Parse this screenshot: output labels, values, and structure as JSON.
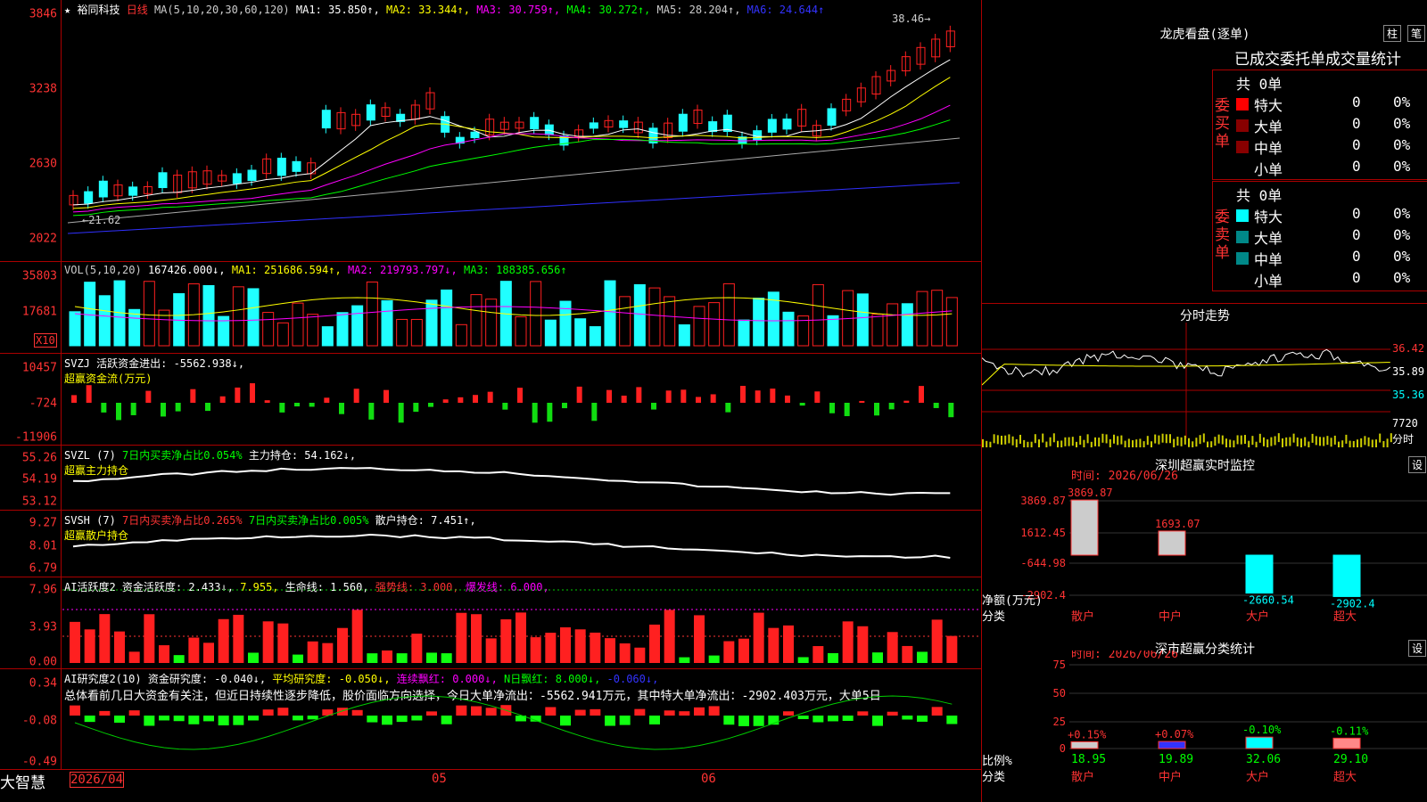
{
  "colors": {
    "up": "#ff2020",
    "down": "#20ffff",
    "ma1": "#ffffff",
    "ma2": "#ffff00",
    "ma3": "#ff00ff",
    "ma4": "#00ff00",
    "ma5": "#aaaaaa",
    "ma6": "#3030ff"
  },
  "main": {
    "title": "★ 裕同科技",
    "period": "日线",
    "ma_label": "MA(5,10,20,30,60,120)",
    "ma1": "MA1: 35.850↑,",
    "ma2": "MA2: 33.344↑,",
    "ma3": "MA3: 30.759↑,",
    "ma4": "MA4: 30.272↑,",
    "ma5": "MA5: 28.204↑,",
    "ma6": "MA6: 24.644↑",
    "hi_label": "38.46→",
    "lo_label": "←21.62",
    "ticks": [
      "3846",
      "3238",
      "2630",
      "2022"
    ]
  },
  "vol": {
    "label": "VOL(5,10,20)",
    "v": "167426.000↓,",
    "ma1": "MA1: 251686.594↑,",
    "ma2": "MA2: 219793.797↓,",
    "ma3": "MA3: 188385.656↑",
    "ticks": [
      "35803",
      "17681"
    ],
    "unit": "X10"
  },
  "svzj": {
    "label": "SVZJ  活跃资金进出: -5562.938↓,",
    "sub": "超赢资金流(万元)",
    "ticks": [
      "10457",
      "-724",
      "-11906"
    ]
  },
  "svzl": {
    "label": "SVZL (7)",
    "g": "7日内买卖净占比0.054%",
    "w": "主力持仓: 54.162↓,",
    "sub": "超赢主力持仓",
    "ticks": [
      "55.26",
      "54.19",
      "53.12"
    ]
  },
  "svsh": {
    "label": "SVSH (7)",
    "r": "7日内买卖净占比0.265%",
    "g": "7日内买卖净占比0.005%",
    "w": "散户持仓: 7.451↑,",
    "sub": "超赢散户持仓",
    "ticks": [
      "9.27",
      "8.01",
      "6.79"
    ]
  },
  "ai": {
    "label": "AI活跃度2",
    "a": "资金活跃度: 2.433↓,",
    "b": "7.955,",
    "c": "生命线: 1.560,",
    "d": "强势线: 3.000,",
    "e": "爆发线: 6.000,",
    "ticks": [
      "7.96",
      "3.93",
      "0.00"
    ]
  },
  "yj": {
    "label": "AI研究度2(10)",
    "a": "资金研究度: -0.040↓,",
    "b": "平均研究度: -0.050↓,",
    "c": "连续飘红: 0.000↓,",
    "d": "N日飘红: 8.000↓,",
    "e": "-0.060↓,",
    "text": "总体看前几日大资金有关注，但近日持续性逐步降低，股价面临方向选择，今日大单净流出：-5562.941万元，其中特大单净流出：-2902.403万元，大单5日",
    "ticks": [
      "0.34",
      "-0.08",
      "-0.49"
    ]
  },
  "xaxis": {
    "d1": "2026/04",
    "d2": "05",
    "d3": "06"
  },
  "brand": "大智慧",
  "lhb": {
    "title": "龙虎看盘(逐单)",
    "btn1": "柱",
    "btn2": "笔",
    "head": "已成交委托单成交量统计",
    "buy": "委买单",
    "sell": "委卖单",
    "total": "共 0单",
    "rows": [
      {
        "n": "特大",
        "v": "0",
        "p": "0%"
      },
      {
        "n": "大单",
        "v": "0",
        "p": "0%"
      },
      {
        "n": "中单",
        "v": "0",
        "p": "0%"
      },
      {
        "n": "小单",
        "v": "0",
        "p": "0%"
      }
    ]
  },
  "fs": {
    "title": "分时走势",
    "t1": "36.42",
    "t2": "35.89",
    "t3": "35.36",
    "t4": "7720",
    "t5": "分时"
  },
  "mon": {
    "title": "深圳超赢实时监控",
    "btn": "设",
    "date": "时间: 2026/06/26",
    "ticks": [
      "3869.87",
      "1612.45",
      "-644.98",
      "-2902.4"
    ],
    "ylab": "净额(万元)",
    "xlab": "分类"
  },
  "cls": {
    "title": "深市超赢分类统计",
    "btn": "设",
    "date": "时间: 2026/06/26",
    "ticks": [
      "75",
      "50",
      "25",
      "0"
    ],
    "ylab": "比例%",
    "xlab": "分类"
  },
  "chart_data": [
    {
      "type": "bar",
      "title": "深圳超赢实时监控",
      "categories": [
        "散户",
        "中户",
        "大户",
        "超大"
      ],
      "values": [
        3869.87,
        1693.07,
        -2660.54,
        -2902.4
      ],
      "ylabel": "净额(万元)"
    },
    {
      "type": "bar",
      "title": "深市超赢分类统计",
      "categories": [
        "散户",
        "中户",
        "大户",
        "超大"
      ],
      "values": [
        18.95,
        19.89,
        32.06,
        29.1
      ],
      "labels": [
        "+0.15%",
        "+0.07%",
        "-0.10%",
        "-0.11%"
      ],
      "ylabel": "比例%",
      "ylim": [
        0,
        75
      ]
    }
  ]
}
